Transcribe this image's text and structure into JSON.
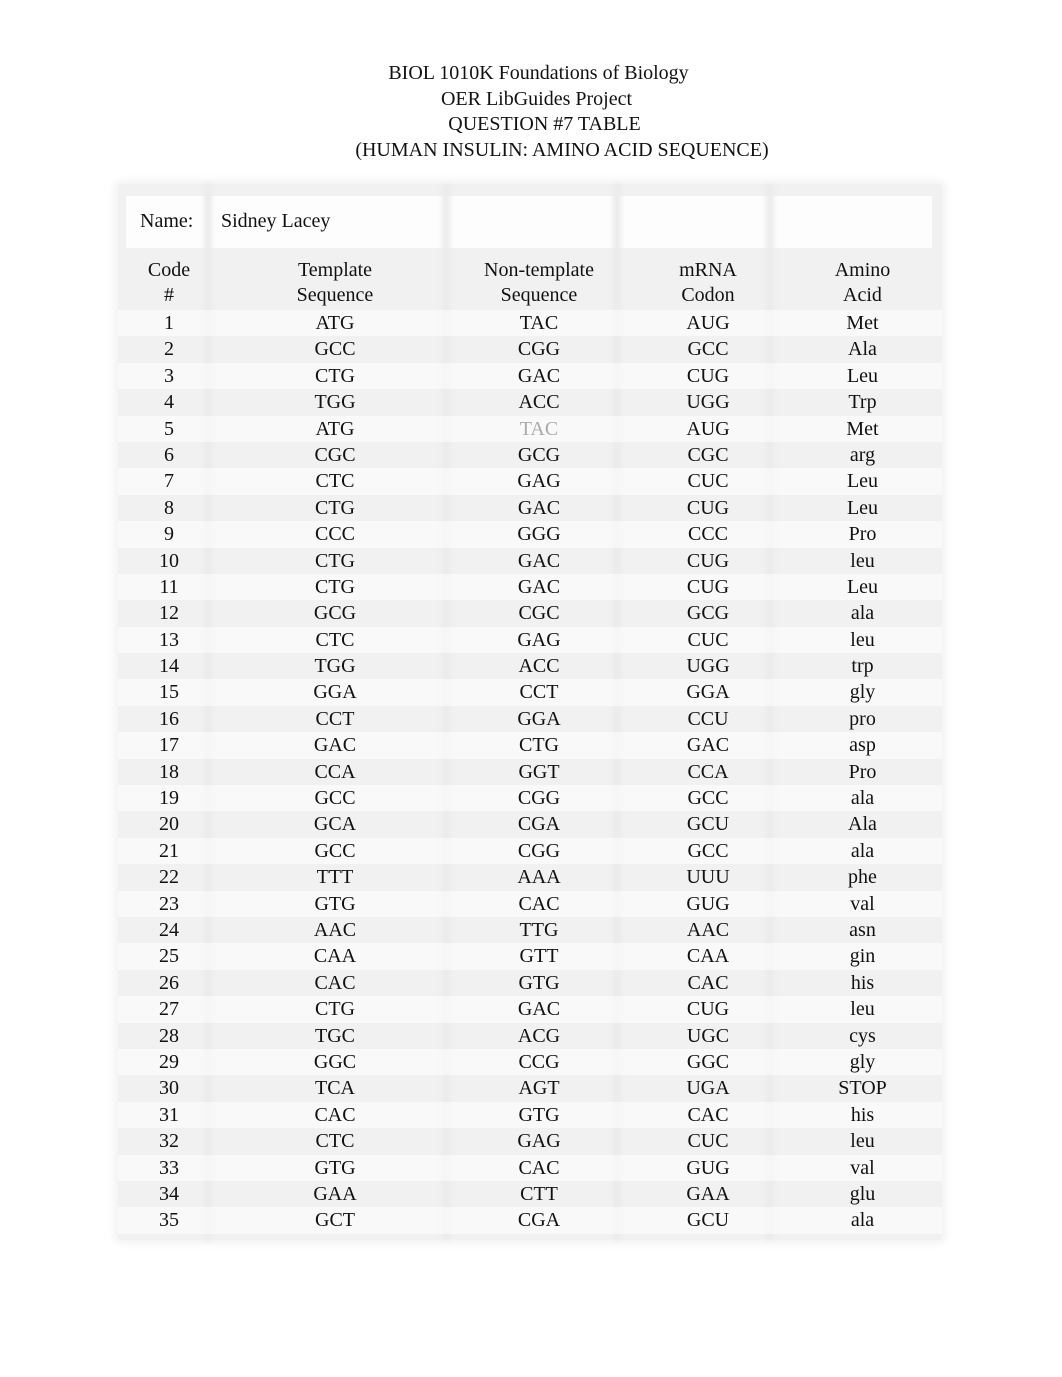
{
  "header": {
    "line1": "BIOL 1010K Foundations of Biology",
    "line2": "OER LibGuides Project",
    "line3": "QUESTION #7 TABLE",
    "line4": "(HUMAN INSULIN: AMINO ACID SEQUENCE)"
  },
  "name_field": {
    "label": "Name:",
    "value": "Sidney Lacey"
  },
  "columns": [
    {
      "line1": "Code",
      "line2": "#"
    },
    {
      "line1": "Template",
      "line2": "Sequence"
    },
    {
      "line1": "Non-template",
      "line2": "Sequence"
    },
    {
      "line1": "mRNA",
      "line2": "Codon"
    },
    {
      "line1": "Amino",
      "line2": "Acid"
    }
  ],
  "rows": [
    {
      "code": "1",
      "template": "ATG",
      "nontemplate": "TAC",
      "mrna": "AUG",
      "amino": "Met"
    },
    {
      "code": "2",
      "template": "GCC",
      "nontemplate": "CGG",
      "mrna": "GCC",
      "amino": "Ala"
    },
    {
      "code": "3",
      "template": "CTG",
      "nontemplate": "GAC",
      "mrna": "CUG",
      "amino": "Leu"
    },
    {
      "code": "4",
      "template": "TGG",
      "nontemplate": "ACC",
      "mrna": "UGG",
      "amino": "Trp"
    },
    {
      "code": "5",
      "template": "ATG",
      "nontemplate": "TAC",
      "mrna": "AUG",
      "amino": "Met",
      "nontemplate_faded": true
    },
    {
      "code": "6",
      "template": "CGC",
      "nontemplate": "GCG",
      "mrna": "CGC",
      "amino": "arg"
    },
    {
      "code": "7",
      "template": "CTC",
      "nontemplate": "GAG",
      "mrna": "CUC",
      "amino": "Leu"
    },
    {
      "code": "8",
      "template": "CTG",
      "nontemplate": "GAC",
      "mrna": "CUG",
      "amino": "Leu"
    },
    {
      "code": "9",
      "template": "CCC",
      "nontemplate": "GGG",
      "mrna": "CCC",
      "amino": "Pro"
    },
    {
      "code": "10",
      "template": "CTG",
      "nontemplate": "GAC",
      "mrna": "CUG",
      "amino": "leu"
    },
    {
      "code": "11",
      "template": "CTG",
      "nontemplate": "GAC",
      "mrna": "CUG",
      "amino": "Leu"
    },
    {
      "code": "12",
      "template": "GCG",
      "nontemplate": "CGC",
      "mrna": "GCG",
      "amino": "ala"
    },
    {
      "code": "13",
      "template": "CTC",
      "nontemplate": "GAG",
      "mrna": "CUC",
      "amino": "leu"
    },
    {
      "code": "14",
      "template": "TGG",
      "nontemplate": "ACC",
      "mrna": "UGG",
      "amino": "trp"
    },
    {
      "code": "15",
      "template": "GGA",
      "nontemplate": "CCT",
      "mrna": "GGA",
      "amino": "gly"
    },
    {
      "code": "16",
      "template": "CCT",
      "nontemplate": "GGA",
      "mrna": "CCU",
      "amino": "pro"
    },
    {
      "code": "17",
      "template": "GAC",
      "nontemplate": "CTG",
      "mrna": "GAC",
      "amino": "asp"
    },
    {
      "code": "18",
      "template": "CCA",
      "nontemplate": "GGT",
      "mrna": "CCA",
      "amino": "Pro"
    },
    {
      "code": "19",
      "template": "GCC",
      "nontemplate": "CGG",
      "mrna": "GCC",
      "amino": "ala"
    },
    {
      "code": "20",
      "template": "GCA",
      "nontemplate": "CGA",
      "mrna": "GCU",
      "amino": "Ala"
    },
    {
      "code": "21",
      "template": "GCC",
      "nontemplate": "CGG",
      "mrna": "GCC",
      "amino": "ala"
    },
    {
      "code": "22",
      "template": "TTT",
      "nontemplate": "AAA",
      "mrna": "UUU",
      "amino": "phe"
    },
    {
      "code": "23",
      "template": "GTG",
      "nontemplate": "CAC",
      "mrna": "GUG",
      "amino": "val"
    },
    {
      "code": "24",
      "template": "AAC",
      "nontemplate": "TTG",
      "mrna": "AAC",
      "amino": "asn"
    },
    {
      "code": "25",
      "template": "CAA",
      "nontemplate": "GTT",
      "mrna": "CAA",
      "amino": "gin"
    },
    {
      "code": "26",
      "template": "CAC",
      "nontemplate": "GTG",
      "mrna": "CAC",
      "amino": "his"
    },
    {
      "code": "27",
      "template": "CTG",
      "nontemplate": "GAC",
      "mrna": "CUG",
      "amino": "leu"
    },
    {
      "code": "28",
      "template": "TGC",
      "nontemplate": "ACG",
      "mrna": "UGC",
      "amino": "cys"
    },
    {
      "code": "29",
      "template": "GGC",
      "nontemplate": "CCG",
      "mrna": "GGC",
      "amino": "gly"
    },
    {
      "code": "30",
      "template": "TCA",
      "nontemplate": "AGT",
      "mrna": "UGA",
      "amino": "STOP"
    },
    {
      "code": "31",
      "template": "CAC",
      "nontemplate": "GTG",
      "mrna": "CAC",
      "amino": "his"
    },
    {
      "code": "32",
      "template": "CTC",
      "nontemplate": "GAG",
      "mrna": "CUC",
      "amino": "leu"
    },
    {
      "code": "33",
      "template": "GTG",
      "nontemplate": "CAC",
      "mrna": "GUG",
      "amino": "val"
    },
    {
      "code": "34",
      "template": "GAA",
      "nontemplate": "CTT",
      "mrna": "GAA",
      "amino": "glu"
    },
    {
      "code": "35",
      "template": "GCT",
      "nontemplate": "CGA",
      "mrna": "GCU",
      "amino": "ala"
    }
  ],
  "colors": {
    "text": "#111111",
    "faded_text": "#aaaaaa",
    "table_bg": "#f1f1f1"
  }
}
